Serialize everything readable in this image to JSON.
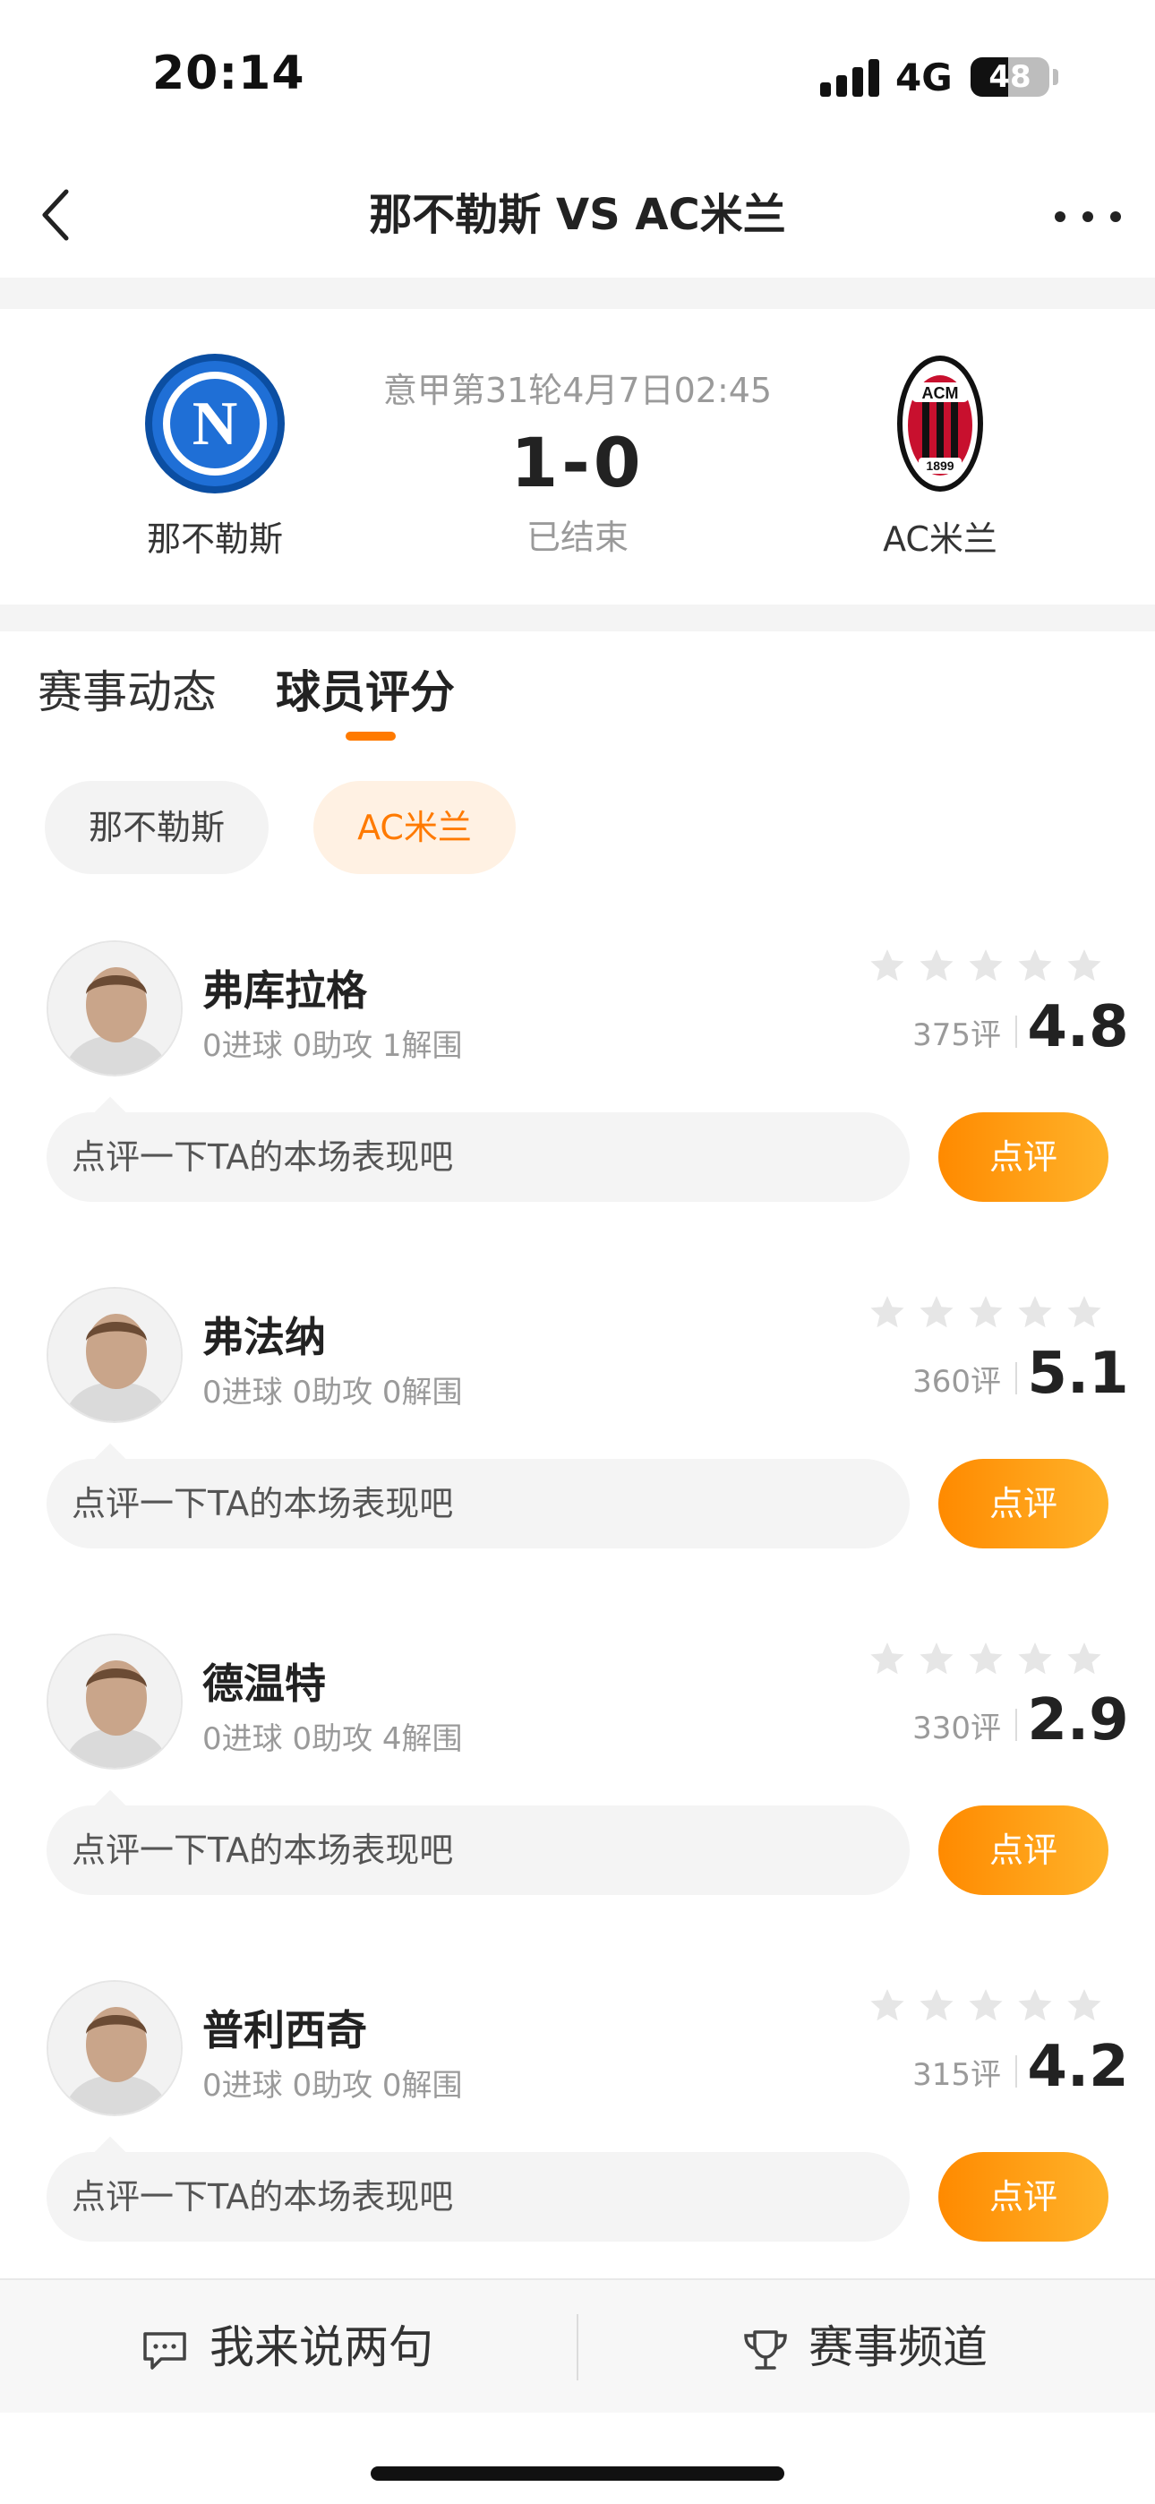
{
  "status_bar": {
    "time": "20:14",
    "network": "4G",
    "battery": "48",
    "battery_level": 0.48
  },
  "nav": {
    "title": "那不勒斯 VS AC米兰"
  },
  "match": {
    "info": "意甲第31轮4月7日02:45",
    "score": "1-0",
    "status": "已结束",
    "home": {
      "name": "那不勒斯",
      "logo_letter": "N",
      "logo_color": "#1f6fd6"
    },
    "away": {
      "name": "AC米兰",
      "logo_text": "ACM",
      "logo_year": "1899",
      "logo_color": "#c8102e"
    }
  },
  "tabs": {
    "events": "赛事动态",
    "ratings": "球员评分"
  },
  "team_filter": {
    "home": "那不勒斯",
    "away": "AC米兰"
  },
  "colors": {
    "accent": "#ff7a00",
    "accent_light": "#ffb32a"
  },
  "comment_placeholder": "点评一下TA的本场表现吧",
  "review_label": "点评",
  "players": [
    {
      "name": "弗库拉格",
      "stats": "0进球  0助攻  1解围",
      "count": "375评",
      "score": "4.8",
      "avatar_icon": "player-photo"
    },
    {
      "name": "弗法纳",
      "stats": "0进球  0助攻  0解围",
      "count": "360评",
      "score": "5.1",
      "avatar_icon": "player-photo"
    },
    {
      "name": "德温特",
      "stats": "0进球  0助攻  4解围",
      "count": "330评",
      "score": "2.9",
      "avatar_icon": "player-photo"
    },
    {
      "name": "普利西奇",
      "stats": "0进球  0助攻  0解围",
      "count": "315评",
      "score": "4.2",
      "avatar_icon": "player-photo"
    }
  ],
  "bottom_bar": {
    "comment": "我来说两句",
    "channel": "赛事频道"
  }
}
